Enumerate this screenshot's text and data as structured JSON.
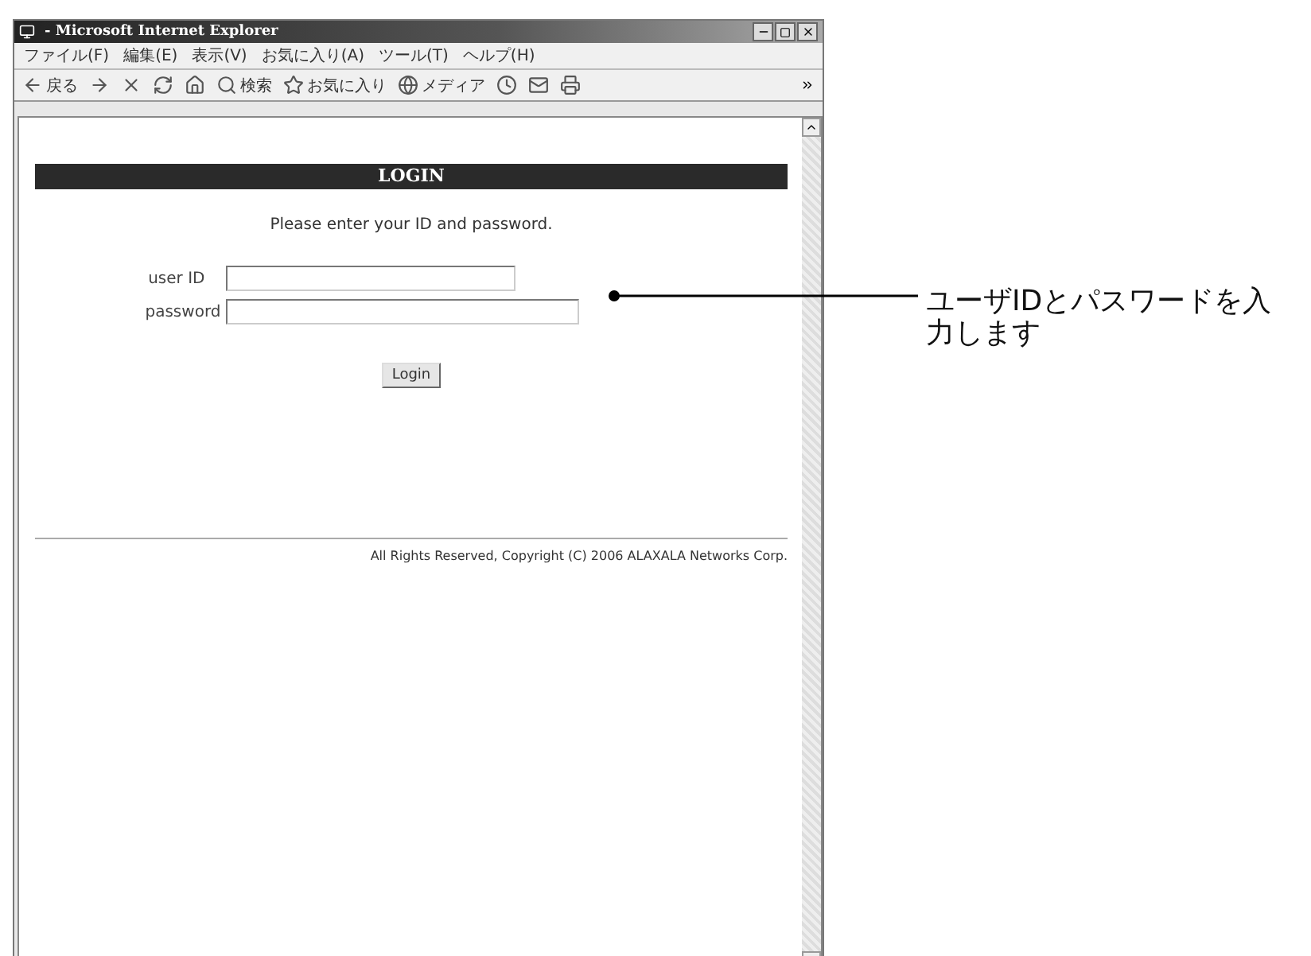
{
  "window": {
    "title": "- Microsoft Internet Explorer"
  },
  "menu": [
    "ファイル(F)",
    "編集(E)",
    "表示(V)",
    "お気に入り(A)",
    "ツール(T)",
    "ヘルプ(H)"
  ],
  "toolbar": [
    {
      "kind": "back",
      "label": "戻る"
    },
    {
      "kind": "forward"
    },
    {
      "kind": "stop"
    },
    {
      "kind": "refresh"
    },
    {
      "kind": "home"
    },
    {
      "kind": "search",
      "label": "検索"
    },
    {
      "kind": "favorites",
      "label": "お気に入り"
    },
    {
      "kind": "media",
      "label": "メディア"
    },
    {
      "kind": "history"
    },
    {
      "kind": "mail"
    },
    {
      "kind": "print"
    }
  ],
  "page": {
    "header": "LOGIN",
    "instruction": "Please enter your ID and password.",
    "fields": [
      {
        "label": "user ID"
      },
      {
        "label": "password"
      }
    ],
    "button": "Login",
    "footer": "All Rights Reserved, Copyright (C) 2006 ALAXALA Networks Corp."
  },
  "annotation": {
    "text": "ユーザIDとパスワードを入力します"
  }
}
